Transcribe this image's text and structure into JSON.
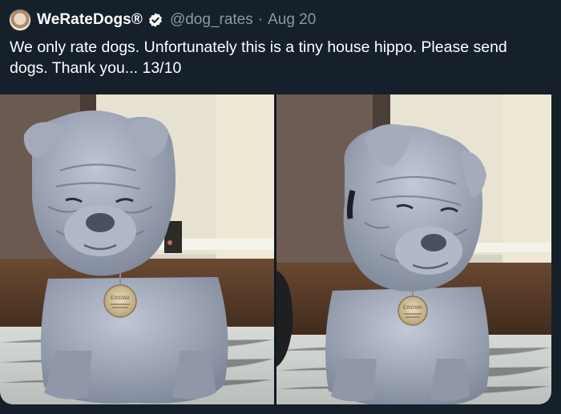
{
  "tweet": {
    "display_name": "WeRateDogs®",
    "handle": "@dog_rates",
    "separator": "·",
    "date": "Aug 20",
    "text": "We only rate dogs. Unfortunately this is a tiny house hippo. Please send dogs. Thank you... 13/10",
    "verified": true
  },
  "media": {
    "count": 2,
    "photos": [
      {
        "tag_text": "EXIOWA"
      },
      {
        "tag_text": "EXIOWA"
      }
    ]
  },
  "colors": {
    "background": "#15202b",
    "text": "#ffffff",
    "muted": "#8899a6",
    "verified_badge": "#ffffff"
  },
  "icons": [
    "avatar",
    "verified-badge-icon"
  ]
}
